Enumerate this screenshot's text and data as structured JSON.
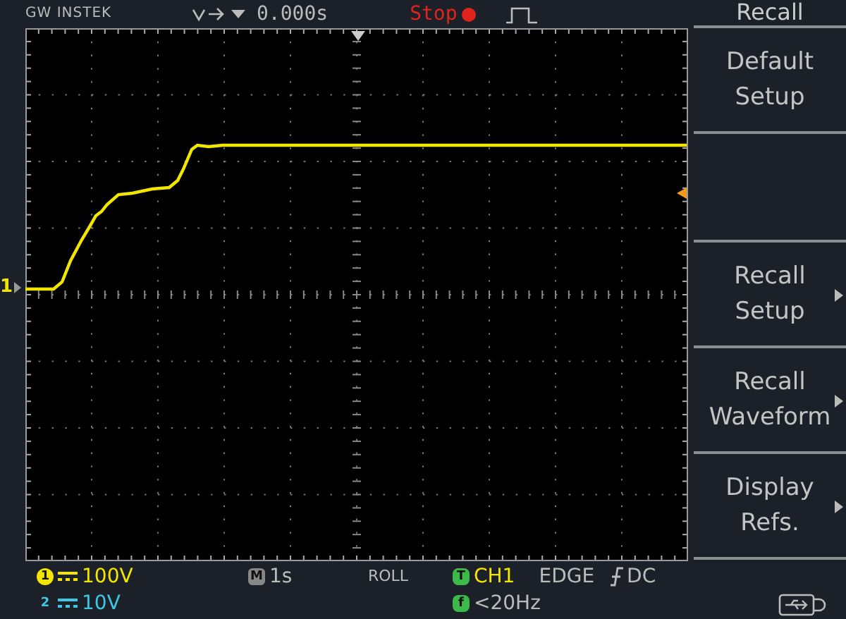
{
  "header": {
    "logo": "GW INSTEK",
    "time_offset": "0.000s",
    "run_state": "Stop"
  },
  "screen": {
    "channel_marker": "1"
  },
  "menu": {
    "title": "Recall",
    "items": [
      {
        "kind": "button",
        "lines": [
          "Default",
          "Setup"
        ],
        "submenu": false
      },
      {
        "kind": "blank"
      },
      {
        "kind": "button",
        "lines": [
          "Recall",
          "Setup"
        ],
        "submenu": true
      },
      {
        "kind": "button",
        "lines": [
          "Recall",
          "Waveform"
        ],
        "submenu": true
      },
      {
        "kind": "button",
        "lines": [
          "Display",
          "Refs."
        ],
        "submenu": true
      }
    ]
  },
  "status": {
    "ch1": {
      "badge": "1",
      "scale": "100V"
    },
    "ch2": {
      "badge": "2",
      "scale": "10V"
    },
    "timebase": {
      "badge": "M",
      "value": "1s"
    },
    "mode": "ROLL",
    "trigger": {
      "badge": "T",
      "source": "CH1",
      "type": "EDGE",
      "coupling": "DC"
    },
    "frequency": {
      "badge": "f",
      "value": "<20Hz"
    }
  }
}
